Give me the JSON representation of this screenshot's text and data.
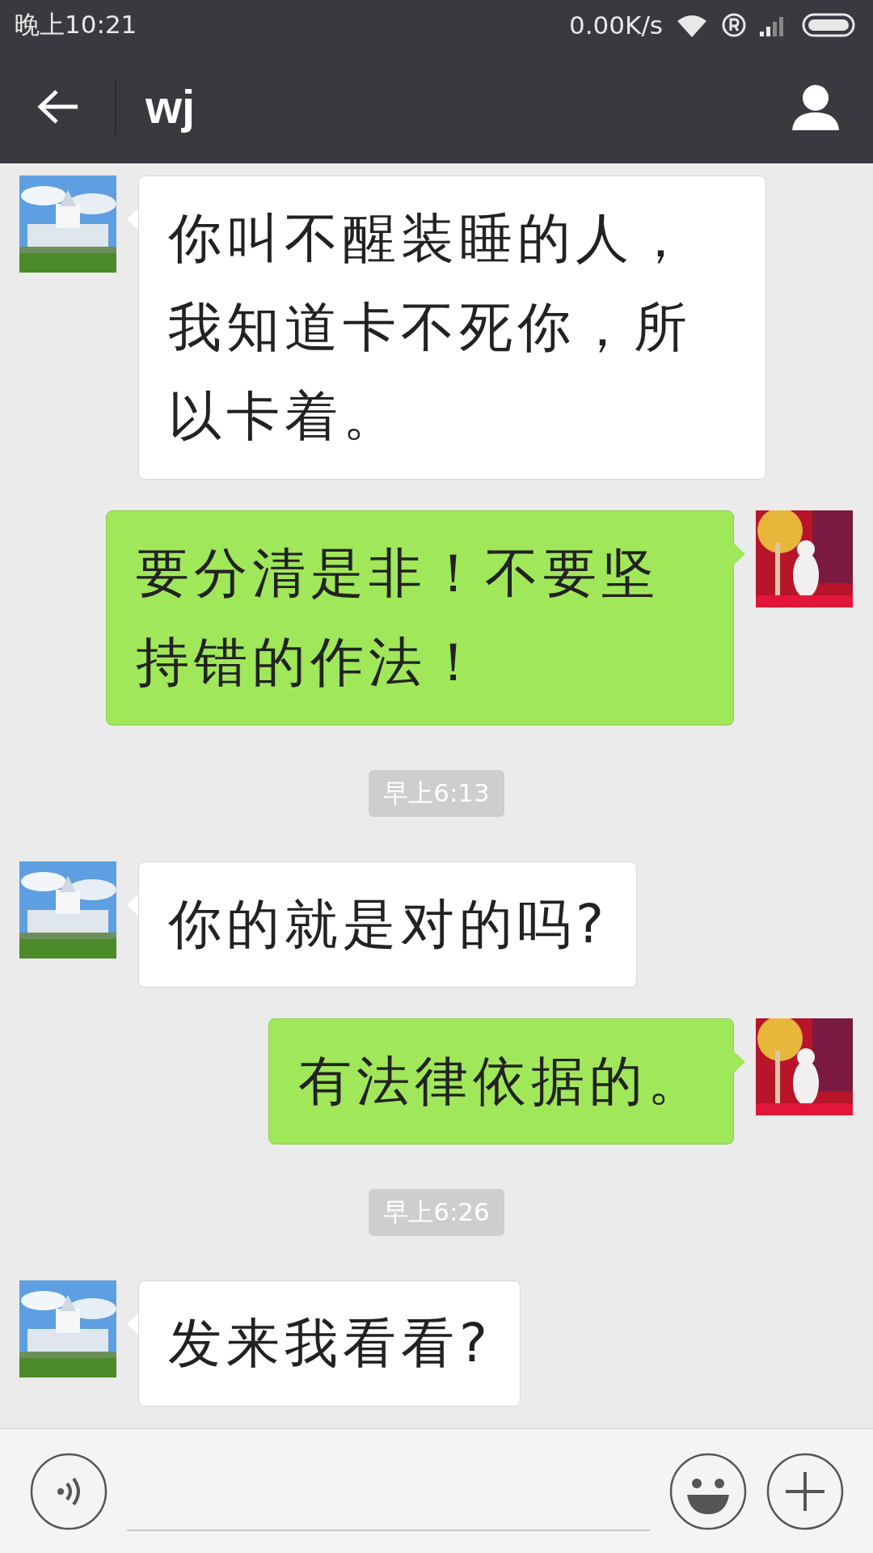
{
  "status_bar": {
    "time": "晚上10:21",
    "speed": "0.00K/s"
  },
  "header": {
    "title": "wj"
  },
  "messages": [
    {
      "kind": "received",
      "text": "你叫不醒装睡的人，我知道卡不死你，所以卡着。"
    },
    {
      "kind": "sent",
      "text": "要分清是非！不要坚持错的作法！"
    },
    {
      "kind": "time",
      "text": "早上6:13"
    },
    {
      "kind": "received",
      "text": "你的就是对的吗?"
    },
    {
      "kind": "sent",
      "text": "有法律依据的。"
    },
    {
      "kind": "time",
      "text": "早上6:26"
    },
    {
      "kind": "received",
      "text": "发来我看看?"
    }
  ]
}
